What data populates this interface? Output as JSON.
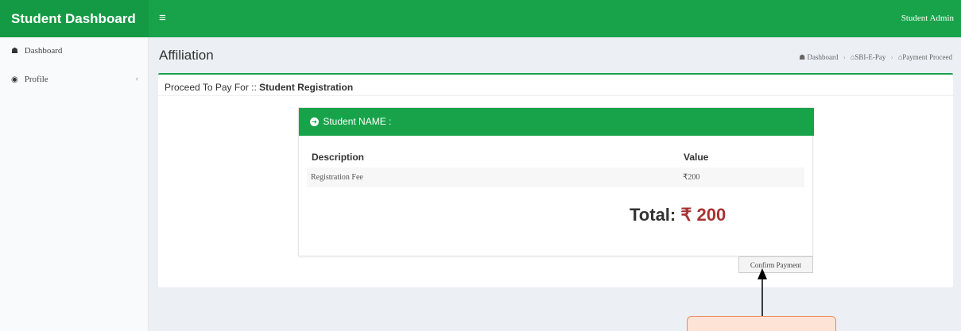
{
  "brand": "Student Dashboard",
  "menu_icon": "≡",
  "user": "Student Admin",
  "sidebar": {
    "items": [
      {
        "icon": "dashboard-icon",
        "label": "Dashboard"
      },
      {
        "icon": "eye-icon",
        "label": "Profile"
      }
    ]
  },
  "page_title": "Affiliation",
  "breadcrumb": [
    "Dashboard",
    "SBI-E-Pay",
    "Payment Proceed"
  ],
  "box": {
    "prefix": "Proceed To Pay For :: ",
    "subject": "Student Registration"
  },
  "panel": {
    "title": "Student NAME :",
    "columns": [
      "Description",
      "Value"
    ],
    "rows": [
      {
        "description": "Registration Fee",
        "value": "₹200"
      }
    ],
    "total_label": "Total: ",
    "total_value": "₹ 200"
  },
  "confirm_button": "Confirm Payment",
  "colors": {
    "primary_green": "#18a34a",
    "total_red": "#a83232",
    "callout_fill": "#fce3d6",
    "callout_border": "#e88a5a"
  }
}
